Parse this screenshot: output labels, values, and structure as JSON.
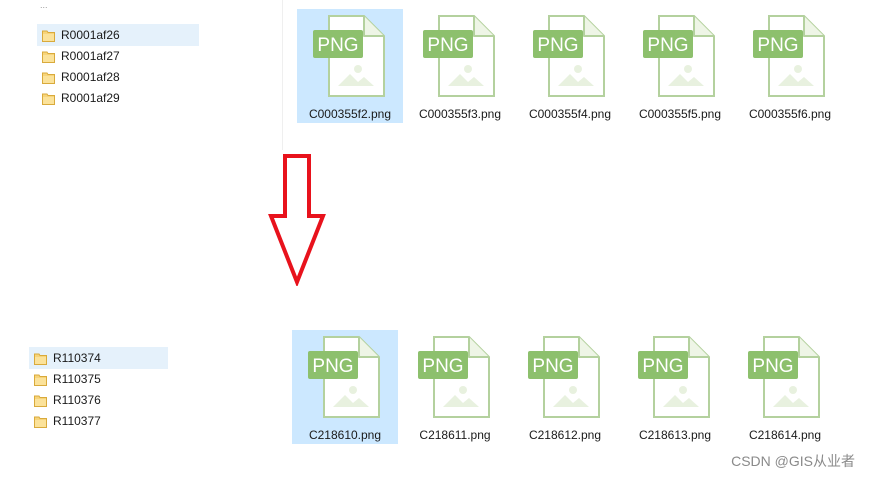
{
  "top": {
    "stray_text": "...",
    "folders": [
      {
        "label": "R0001af26",
        "selected": true
      },
      {
        "label": "R0001af27",
        "selected": false
      },
      {
        "label": "R0001af28",
        "selected": false
      },
      {
        "label": "R0001af29",
        "selected": false
      }
    ],
    "files": [
      {
        "name": "C000355f2.png",
        "selected": true
      },
      {
        "name": "C000355f3.png",
        "selected": false
      },
      {
        "name": "C000355f4.png",
        "selected": false
      },
      {
        "name": "C000355f5.png",
        "selected": false
      },
      {
        "name": "C000355f6.png",
        "selected": false
      }
    ]
  },
  "bottom": {
    "folders": [
      {
        "label": "R110374",
        "selected": true
      },
      {
        "label": "R110375",
        "selected": false
      },
      {
        "label": "R110376",
        "selected": false
      },
      {
        "label": "R110377",
        "selected": false
      }
    ],
    "files": [
      {
        "name": "C218610.png",
        "selected": true
      },
      {
        "name": "C218611.png",
        "selected": false
      },
      {
        "name": "C218612.png",
        "selected": false
      },
      {
        "name": "C218613.png",
        "selected": false
      },
      {
        "name": "C218614.png",
        "selected": false
      }
    ]
  },
  "icons": {
    "folder": "folder-icon",
    "file": "png-file-icon",
    "arrow": "down-arrow-icon"
  },
  "colors": {
    "png_badge": "#8dc06d",
    "png_outline": "#b4d19e",
    "arrow": "#e8121c",
    "folder": "#f7d47a",
    "selection": "#cce8ff"
  },
  "png_badge_text": "PNG",
  "watermark": "CSDN @GIS从业者"
}
